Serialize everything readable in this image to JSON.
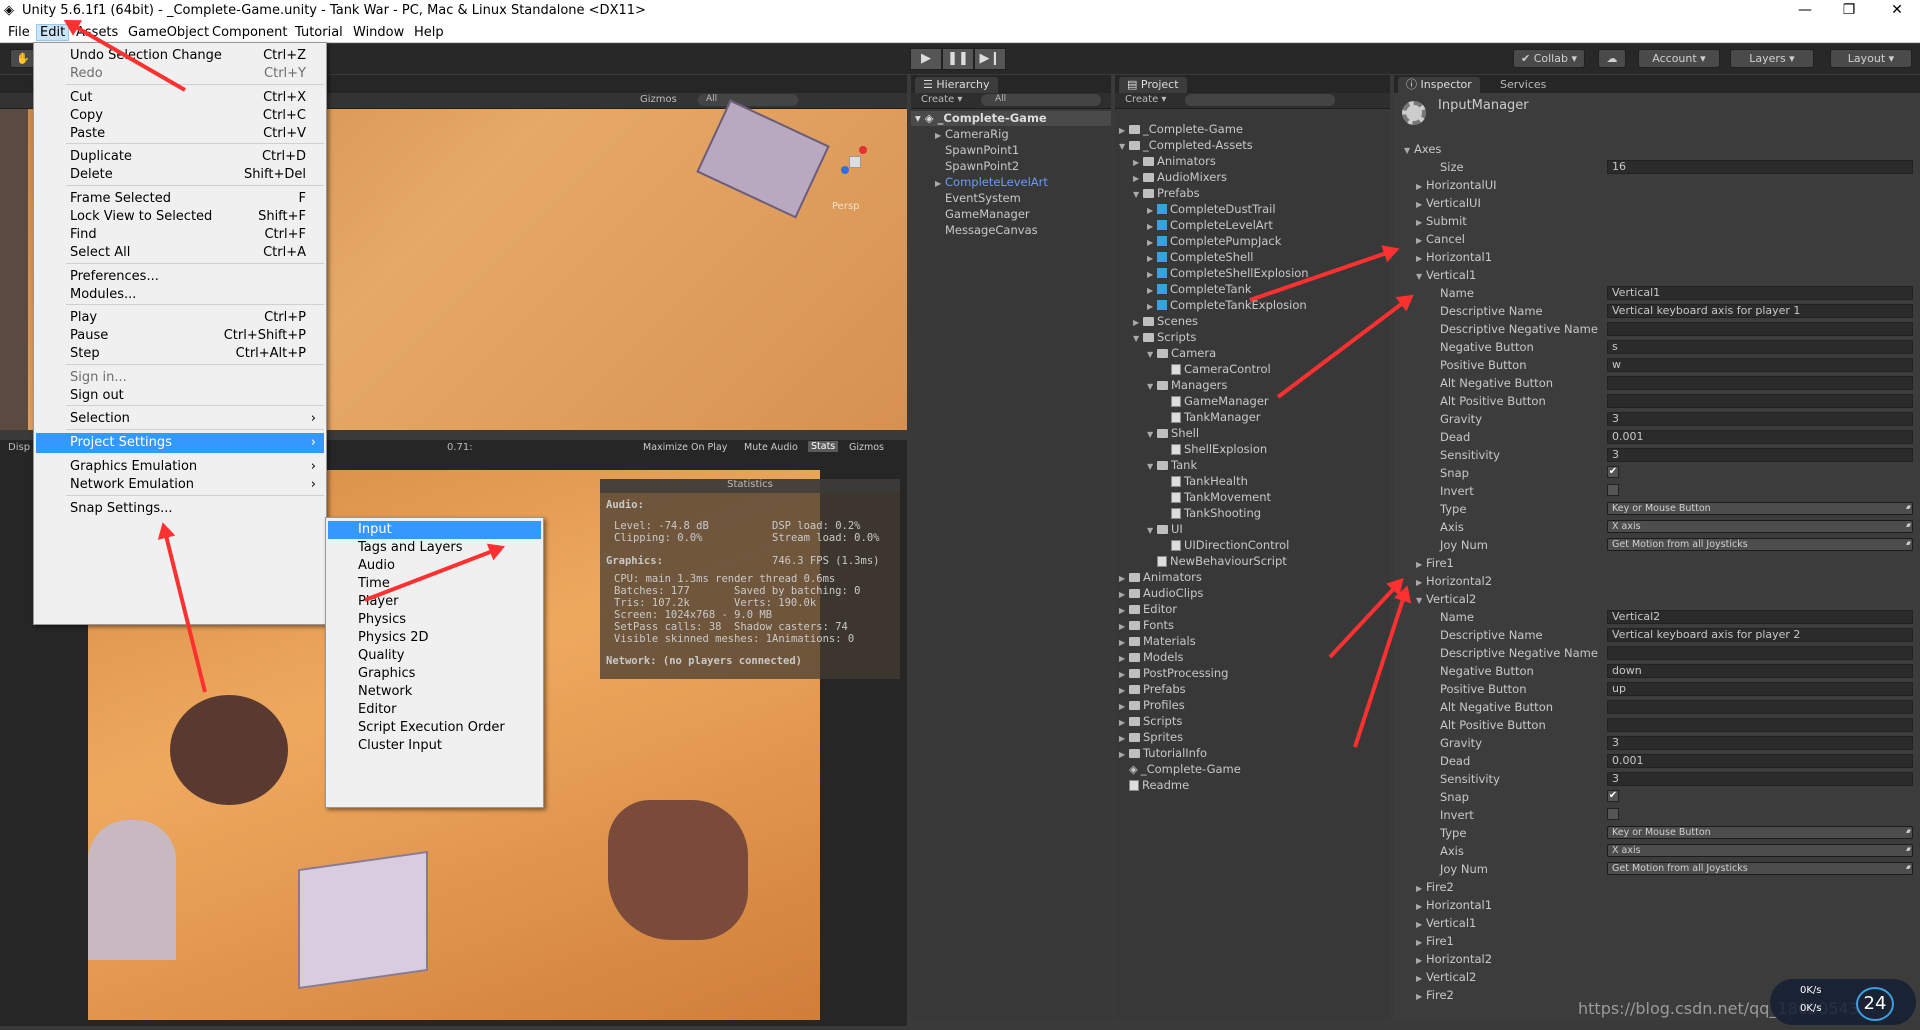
{
  "window": {
    "title": "Unity 5.6.1f1 (64bit) - _Complete-Game.unity - Tank War - PC, Mac & Linux Standalone <DX11>"
  },
  "menubar": [
    "File",
    "Edit",
    "Assets",
    "GameObject",
    "Component",
    "Tutorial",
    "Window",
    "Help"
  ],
  "toolbar": {
    "collab": "Collab",
    "account": "Account",
    "layers": "Layers",
    "layout": "Layout"
  },
  "scene": {
    "gizmos": "Gizmos",
    "search": "All",
    "persp": "Persp"
  },
  "game": {
    "scale": "0.71:",
    "maximize": "Maximize On Play",
    "mute": "Mute Audio",
    "stats": "Stats",
    "gizmos": "Gizmos",
    "tab_left": "Disp"
  },
  "stats": {
    "title": "Statistics",
    "audio_label": "Audio:",
    "level": "Level: -74.8 dB",
    "clipping": "Clipping: 0.0%",
    "dsp": "DSP load: 0.2%",
    "stream": "Stream load: 0.0%",
    "graphics_label": "Graphics:",
    "fps": "746.3 FPS (1.3ms)",
    "cpu": "CPU: main 1.3ms  render thread 0.6ms",
    "batches": "Batches: 177",
    "saved": "Saved by batching: 0",
    "tris": "Tris: 107.2k",
    "verts": "Verts: 190.0k",
    "screen": "Screen: 1024x768 - 9.0 MB",
    "setpass": "SetPass calls: 38",
    "shadow": "Shadow casters: 74",
    "skinned": "Visible skinned meshes: 1",
    "anims": "Animations: 0",
    "network": "Network: (no players connected)"
  },
  "edit_menu": {
    "items": [
      {
        "label": "Undo Selection Change",
        "shortcut": "Ctrl+Z"
      },
      {
        "label": "Redo",
        "shortcut": "Ctrl+Y"
      },
      {
        "label": "Cut",
        "shortcut": "Ctrl+X"
      },
      {
        "label": "Copy",
        "shortcut": "Ctrl+C"
      },
      {
        "label": "Paste",
        "shortcut": "Ctrl+V"
      },
      {
        "label": "Duplicate",
        "shortcut": "Ctrl+D"
      },
      {
        "label": "Delete",
        "shortcut": "Shift+Del"
      },
      {
        "label": "Frame Selected",
        "shortcut": "F"
      },
      {
        "label": "Lock View to Selected",
        "shortcut": "Shift+F"
      },
      {
        "label": "Find",
        "shortcut": "Ctrl+F"
      },
      {
        "label": "Select All",
        "shortcut": "Ctrl+A"
      },
      {
        "label": "Preferences...",
        "shortcut": ""
      },
      {
        "label": "Modules...",
        "shortcut": ""
      },
      {
        "label": "Play",
        "shortcut": "Ctrl+P"
      },
      {
        "label": "Pause",
        "shortcut": "Ctrl+Shift+P"
      },
      {
        "label": "Step",
        "shortcut": "Ctrl+Alt+P"
      },
      {
        "label": "Sign in...",
        "shortcut": ""
      },
      {
        "label": "Sign out",
        "shortcut": ""
      },
      {
        "label": "Selection",
        "shortcut": ""
      },
      {
        "label": "Project Settings",
        "shortcut": ""
      },
      {
        "label": "Graphics Emulation",
        "shortcut": ""
      },
      {
        "label": "Network Emulation",
        "shortcut": ""
      },
      {
        "label": "Snap Settings...",
        "shortcut": ""
      }
    ]
  },
  "submenu": [
    "Input",
    "Tags and Layers",
    "Audio",
    "Time",
    "Player",
    "Physics",
    "Physics 2D",
    "Quality",
    "Graphics",
    "Network",
    "Editor",
    "Script Execution Order",
    "Cluster Input"
  ],
  "hierarchy": {
    "tab": "Hierarchy",
    "create": "Create",
    "search": "All",
    "scene": "_Complete-Game",
    "items": [
      "CameraRig",
      "SpawnPoint1",
      "SpawnPoint2",
      "CompleteLevelArt",
      "EventSystem",
      "GameManager",
      "MessageCanvas"
    ]
  },
  "project": {
    "tab": "Project",
    "create": "Create",
    "items": [
      "_Complete-Game",
      "_Completed-Assets",
      "Animators",
      "AudioMixers",
      "Prefabs",
      "CompleteDustTrail",
      "CompleteLevelArt",
      "CompletePumpJack",
      "CompleteShell",
      "CompleteShellExplosion",
      "CompleteTank",
      "CompleteTankExplosion",
      "Scenes",
      "Scripts",
      "Camera",
      "CameraControl",
      "Managers",
      "GameManager",
      "TankManager",
      "Shell",
      "ShellExplosion",
      "Tank",
      "TankHealth",
      "TankMovement",
      "TankShooting",
      "UI",
      "UIDirectionControl",
      "NewBehaviourScript",
      "Animators",
      "AudioClips",
      "Editor",
      "Fonts",
      "Materials",
      "Models",
      "PostProcessing",
      "Prefabs",
      "Profiles",
      "Scripts",
      "Sprites",
      "TutorialInfo",
      "_Complete-Game",
      "Readme"
    ]
  },
  "inspector": {
    "tab": "Inspector",
    "services": "Services",
    "title": "InputManager",
    "axes": "Axes",
    "size_label": "Size",
    "size_value": "16",
    "top_list": [
      "HorizontalUI",
      "VerticalUI",
      "Submit",
      "Cancel",
      "Horizontal1",
      "Vertical1"
    ],
    "field_labels": [
      "Name",
      "Descriptive Name",
      "Descriptive Negative Name",
      "Negative Button",
      "Positive Button",
      "Alt Negative Button",
      "Alt Positive Button",
      "Gravity",
      "Dead",
      "Sensitivity",
      "Snap",
      "Invert",
      "Type",
      "Axis",
      "Joy Num"
    ],
    "v1": {
      "name": "Vertical1",
      "desc": "Vertical keyboard axis for player 1",
      "descneg": "",
      "neg": "s",
      "pos": "w",
      "altneg": "",
      "altpos": "",
      "gravity": "3",
      "dead": "0.001",
      "sens": "3",
      "type": "Key or Mouse Button",
      "axis": "X axis",
      "joy": "Get Motion from all Joysticks"
    },
    "mid_list": [
      "Fire1",
      "Horizontal2",
      "Vertical2"
    ],
    "v2": {
      "name": "Vertical2",
      "desc": "Vertical keyboard axis for player 2",
      "descneg": "",
      "neg": "down",
      "pos": "up",
      "altneg": "",
      "altpos": "",
      "gravity": "3",
      "dead": "0.001",
      "sens": "3",
      "type": "Key or Mouse Button",
      "axis": "X axis",
      "joy": "Get Motion from all Joysticks"
    },
    "bottom_list": [
      "Fire2",
      "Horizontal1",
      "Vertical1",
      "Fire1",
      "Horizontal2",
      "Vertical2",
      "Fire2"
    ]
  },
  "watermark": "https://blog.csdn.net/qq_18020543",
  "netmeter": {
    "up": "0K/s",
    "down": "0K/s",
    "value": "24"
  }
}
